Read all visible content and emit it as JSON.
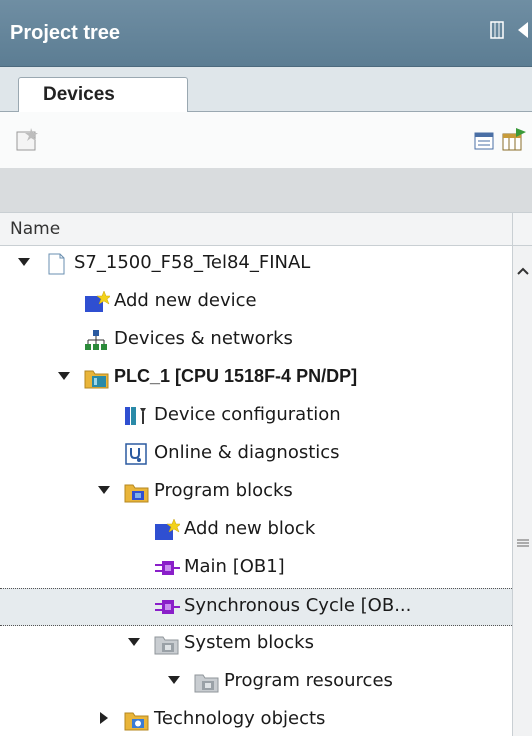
{
  "panel": {
    "title": "Project tree"
  },
  "tabs": [
    {
      "label": "Devices"
    }
  ],
  "columns": {
    "name": "Name"
  },
  "tree": [
    {
      "label": "S7_1500_F58_Tel84_FINAL",
      "icon": "project-icon"
    },
    {
      "label": "Add new device",
      "icon": "add-device-icon"
    },
    {
      "label": "Devices & networks",
      "icon": "network-icon"
    },
    {
      "label": "PLC_1 [CPU 1518F-4 PN/DP]",
      "icon": "plc-folder-icon"
    },
    {
      "label": "Device configuration",
      "icon": "device-config-icon"
    },
    {
      "label": "Online & diagnostics",
      "icon": "diagnostics-icon"
    },
    {
      "label": "Program blocks",
      "icon": "program-blocks-folder-icon"
    },
    {
      "label": "Add new block",
      "icon": "add-block-icon"
    },
    {
      "label": "Main [OB1]",
      "icon": "ob-block-icon"
    },
    {
      "label": "Synchronous Cycle [OB...",
      "icon": "ob-block-icon"
    },
    {
      "label": "System blocks",
      "icon": "system-blocks-folder-icon"
    },
    {
      "label": "Program resources",
      "icon": "program-resources-folder-icon"
    },
    {
      "label": "Technology objects",
      "icon": "technology-folder-icon"
    }
  ],
  "colors": {
    "header": "#5c7d93",
    "selected": "#e6ebee"
  }
}
